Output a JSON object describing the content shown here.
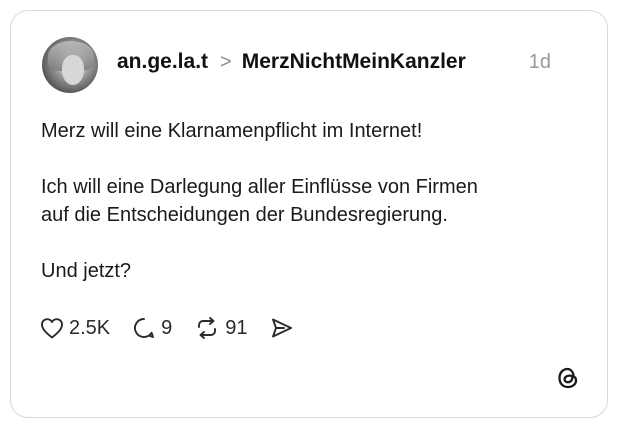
{
  "post": {
    "username": "an.ge.la.t",
    "separator": ">",
    "community": "MerzNichtMeinKanzler",
    "time": "1d",
    "lines": [
      "Merz will eine Klarnamenpflicht im Internet!",
      "",
      "Ich will eine Darlegung aller Einflüsse von Firmen",
      "auf die Entscheidungen der Bundesregierung.",
      "",
      "Und jetzt?"
    ]
  },
  "actions": {
    "likes": "2.5K",
    "replies": "9",
    "reposts": "91"
  },
  "icons": {
    "like": "heart-icon",
    "reply": "comment-icon",
    "repost": "repost-icon",
    "share": "send-icon",
    "brand": "threads-logo-icon"
  }
}
